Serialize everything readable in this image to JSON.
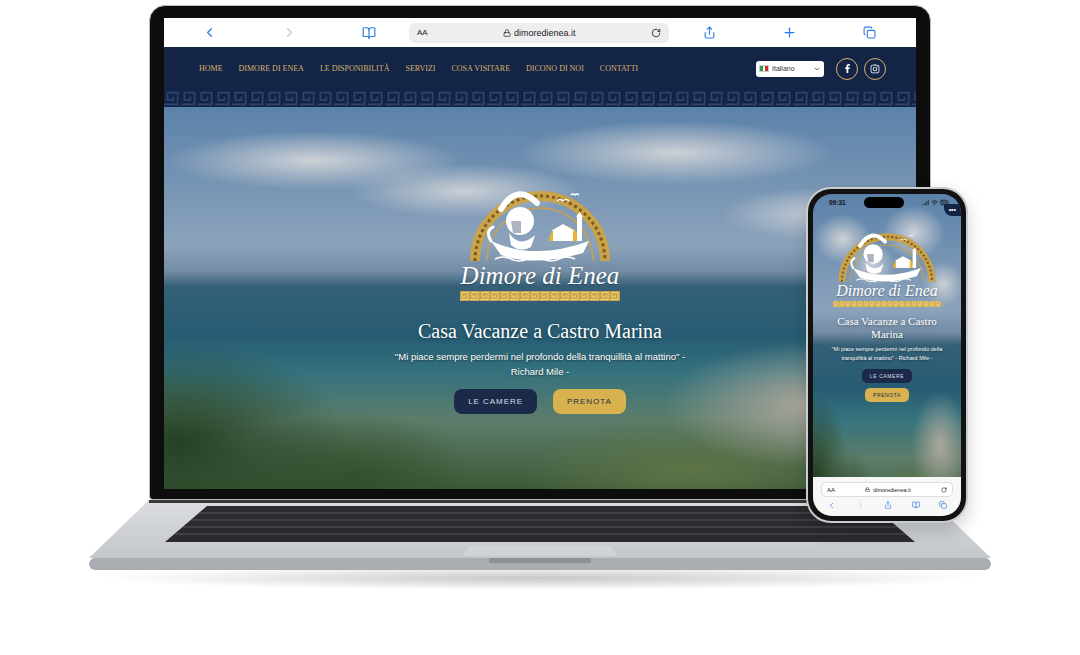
{
  "laptop": {
    "browser": {
      "text_size": "AA",
      "url": "dimoredienea.it"
    },
    "nav": {
      "items": [
        {
          "label": "HOME"
        },
        {
          "label": "DIMORE DI ENEA"
        },
        {
          "label": "LE DISPONIBILITÀ"
        },
        {
          "label": "SERVIZI"
        },
        {
          "label": "COSA VISITARE"
        },
        {
          "label": "DICONO DI NOI"
        },
        {
          "label": "CONTATTI"
        }
      ],
      "language": "Italiano"
    },
    "hero": {
      "brand": "Dimore di Enea",
      "title": "Casa Vacanze a Castro Marina",
      "quote": "\"Mi piace sempre perdermi nel profondo della tranquillità al mattino\" - Richard Mile -",
      "buttons": [
        {
          "label": "LE CAMERE",
          "kind": "primary"
        },
        {
          "label": "PRENOTA",
          "kind": "accent"
        }
      ]
    }
  },
  "phone": {
    "status": {
      "time": "09:31"
    },
    "menu": "•••",
    "hero": {
      "brand": "Dimore di Enea",
      "title": "Casa Vacanze a Castro Marina",
      "quote": "\"Mi piace sempre perdermi nel profondo della tranquillità al mattino\" - Richard Mile -",
      "buttons": [
        {
          "label": "LE CAMERE",
          "kind": "primary"
        },
        {
          "label": "PRENOTA",
          "kind": "accent"
        }
      ]
    },
    "browser": {
      "text_size": "AA",
      "url": "dimoredienea.it"
    }
  }
}
